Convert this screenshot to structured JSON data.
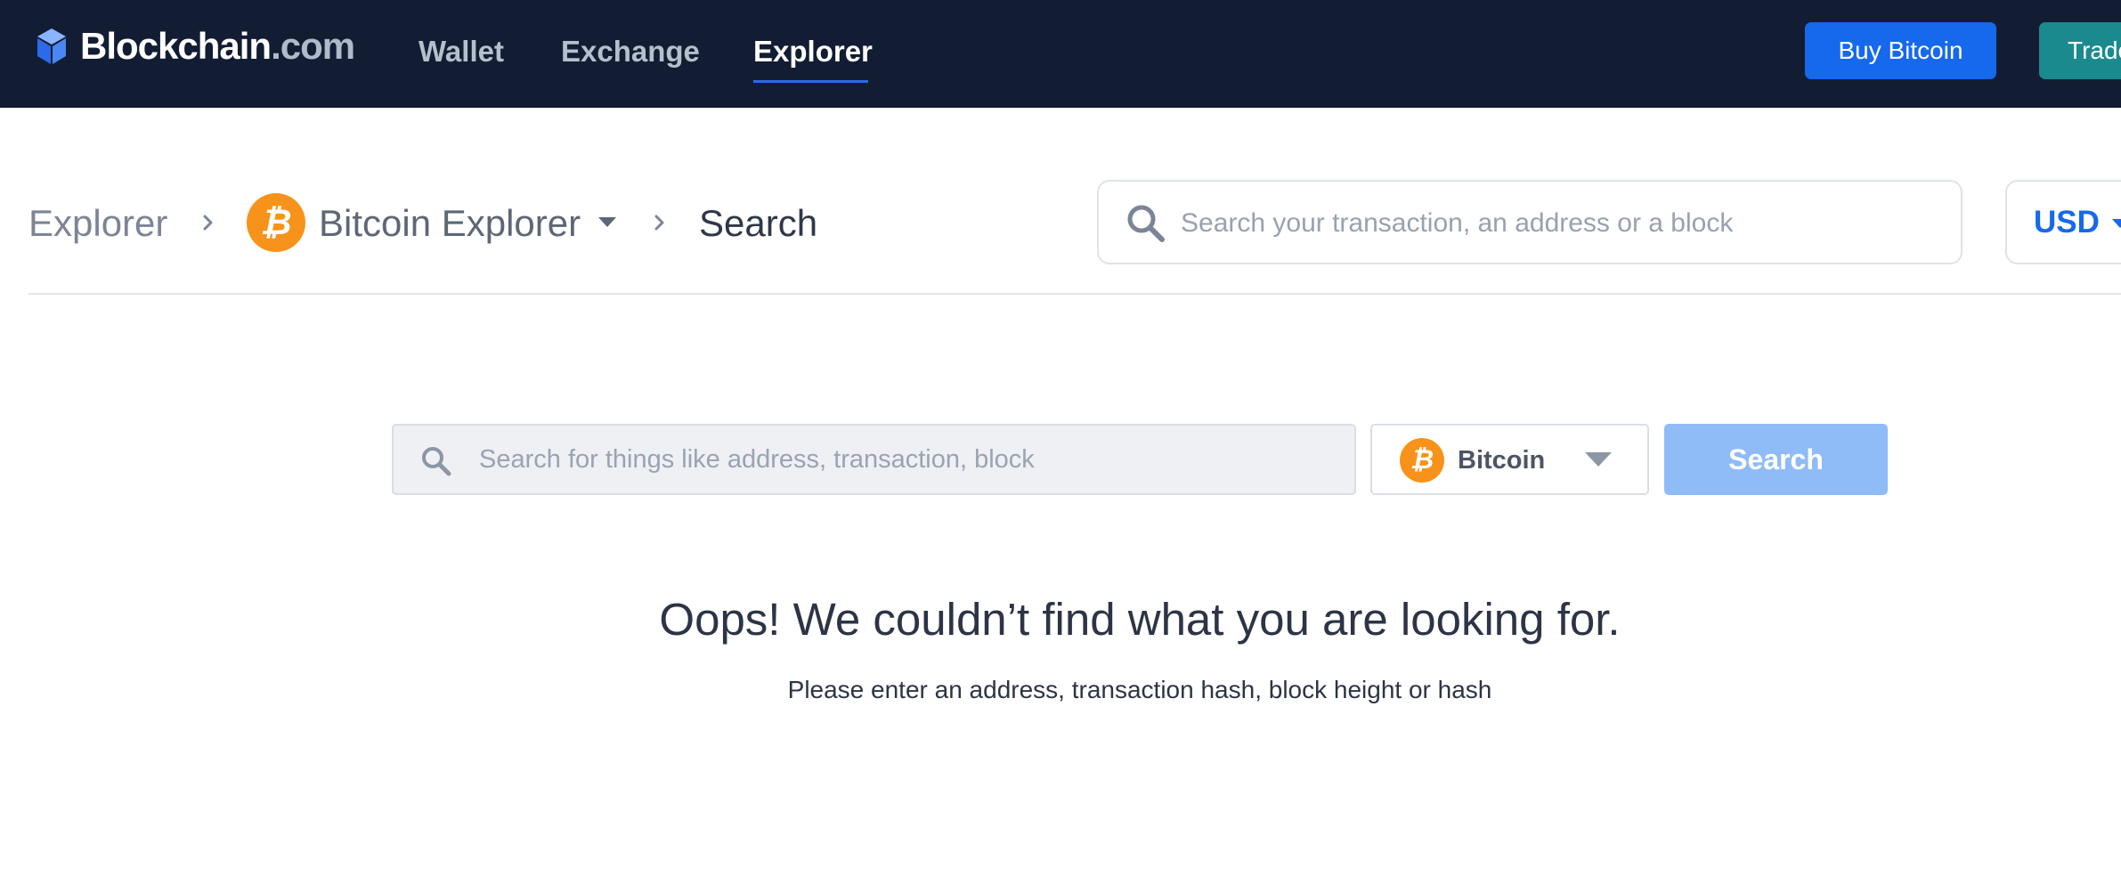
{
  "colors": {
    "nav_bg": "#121d33",
    "accent_blue": "#1668ec",
    "trade_teal": "#1b8a8e",
    "bitcoin_orange": "#f7931a",
    "search_button_disabled": "#8fbbf7"
  },
  "header": {
    "brand": {
      "name": "Blockchain",
      "tld": ".com",
      "logo_icon": "blockchain-cube-icon"
    },
    "nav": [
      {
        "label": "Wallet",
        "active": false
      },
      {
        "label": "Exchange",
        "active": false
      },
      {
        "label": "Explorer",
        "active": true
      }
    ],
    "buy_button": "Buy Bitcoin",
    "trade_button": "Trade"
  },
  "breadcrumb": {
    "root": "Explorer",
    "network": {
      "label": "Bitcoin Explorer",
      "icon": "bitcoin-icon",
      "glyph": "₿"
    },
    "current": "Search",
    "separator_icon": "chevron-right-icon"
  },
  "top_search": {
    "placeholder": "Search your transaction, an address or a block",
    "icon": "search-icon"
  },
  "currency": {
    "selected": "USD"
  },
  "main_search": {
    "placeholder": "Search for things like address, transaction, block",
    "asset": {
      "label": "Bitcoin",
      "glyph": "₿"
    },
    "button": "Search",
    "button_enabled": false
  },
  "message": {
    "title": "Oops! We couldn’t find what you are looking for.",
    "subtitle": "Please enter an address, transaction hash, block height or hash"
  }
}
